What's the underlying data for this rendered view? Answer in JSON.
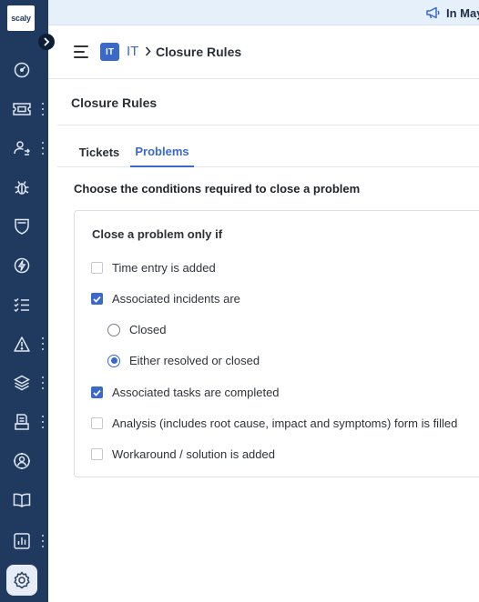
{
  "sidebar": {
    "logo": "scaly",
    "items": [
      {
        "icon": "dashboard-icon",
        "has_menu": false
      },
      {
        "icon": "ticket-icon",
        "has_menu": true
      },
      {
        "icon": "user-switch-icon",
        "has_menu": true
      },
      {
        "icon": "bug-icon",
        "has_menu": false
      },
      {
        "icon": "shield-icon",
        "has_menu": false
      },
      {
        "icon": "lightning-icon",
        "has_menu": false
      },
      {
        "icon": "checklist-icon",
        "has_menu": false
      },
      {
        "icon": "warning-icon",
        "has_menu": true
      },
      {
        "icon": "layers-icon",
        "has_menu": true
      },
      {
        "icon": "printer-icon",
        "has_menu": true
      },
      {
        "icon": "support-icon",
        "has_menu": false
      },
      {
        "icon": "book-icon",
        "has_menu": false
      },
      {
        "icon": "report-icon",
        "has_menu": true
      },
      {
        "icon": "settings-icon",
        "has_menu": false,
        "active": true
      }
    ]
  },
  "topbar": {
    "announcement": "In May"
  },
  "header": {
    "workspace_badge": "IT",
    "workspace": "IT",
    "page": "Closure Rules"
  },
  "page_title": "Closure Rules",
  "tabs": [
    {
      "label": "Tickets",
      "active": false
    },
    {
      "label": "Problems",
      "active": true
    }
  ],
  "section_heading": "Choose the conditions required to close a problem",
  "card": {
    "title": "Close a problem only if",
    "options": [
      {
        "label": "Time entry is added",
        "checked": false
      },
      {
        "label": "Associated incidents are",
        "checked": true
      },
      {
        "label": "Associated tasks are completed",
        "checked": true
      },
      {
        "label": "Analysis (includes root cause, impact and symptoms) form is filled",
        "checked": false
      },
      {
        "label": "Workaround / solution is added",
        "checked": false
      }
    ],
    "incident_states": [
      {
        "label": "Closed",
        "selected": false
      },
      {
        "label": "Either resolved or closed",
        "selected": true
      }
    ]
  },
  "colors": {
    "sidebar": "#1f3a5e",
    "accent": "#3b69c9",
    "topbar": "#e6f0fb"
  }
}
